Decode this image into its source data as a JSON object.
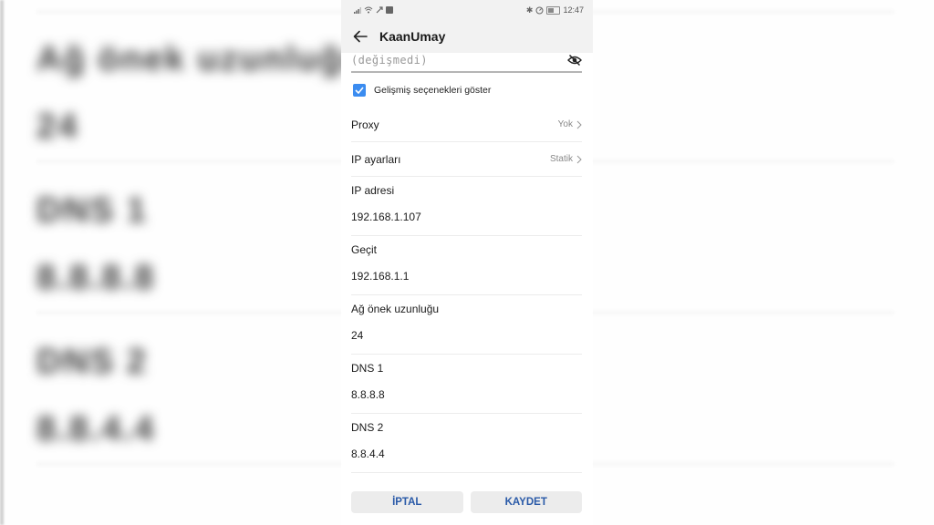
{
  "status_bar": {
    "time": "12:47",
    "left_icons": [
      "signal-icon",
      "wifi-icon",
      "usb-icon",
      "notification-icon"
    ],
    "right_icons": [
      "bluetooth-icon",
      "data-saver-icon",
      "battery-icon"
    ],
    "battery_level": "40"
  },
  "app_bar": {
    "back_icon": "arrow-left-icon",
    "title": "KaanUmay"
  },
  "password": {
    "value": "(değişmedi)",
    "toggle_icon": "eye-off-icon"
  },
  "advanced": {
    "checked": true,
    "label": "Gelişmiş seçenekleri göster",
    "accent": "#3b8cf0"
  },
  "proxy": {
    "label": "Proxy",
    "value": "Yok"
  },
  "ip_settings": {
    "label": "IP ayarları",
    "value": "Statik"
  },
  "fields": [
    {
      "label": "IP adresi",
      "value": "192.168.1.107"
    },
    {
      "label": "Geçit",
      "value": "192.168.1.1"
    },
    {
      "label": "Ağ önek uzunluğu",
      "value": "24"
    },
    {
      "label": "DNS 1",
      "value": "8.8.8.8"
    },
    {
      "label": "DNS 2",
      "value": "8.8.4.4"
    }
  ],
  "buttons": {
    "cancel": "İPTAL",
    "save": "KAYDET",
    "text_color": "#2a5aa8"
  },
  "background_blur": {
    "texts": [
      "Ağ önek uzunluğu",
      "24",
      "DNS 1",
      "8.8.8.8",
      "DNS 2",
      "8.8.4.4"
    ]
  }
}
